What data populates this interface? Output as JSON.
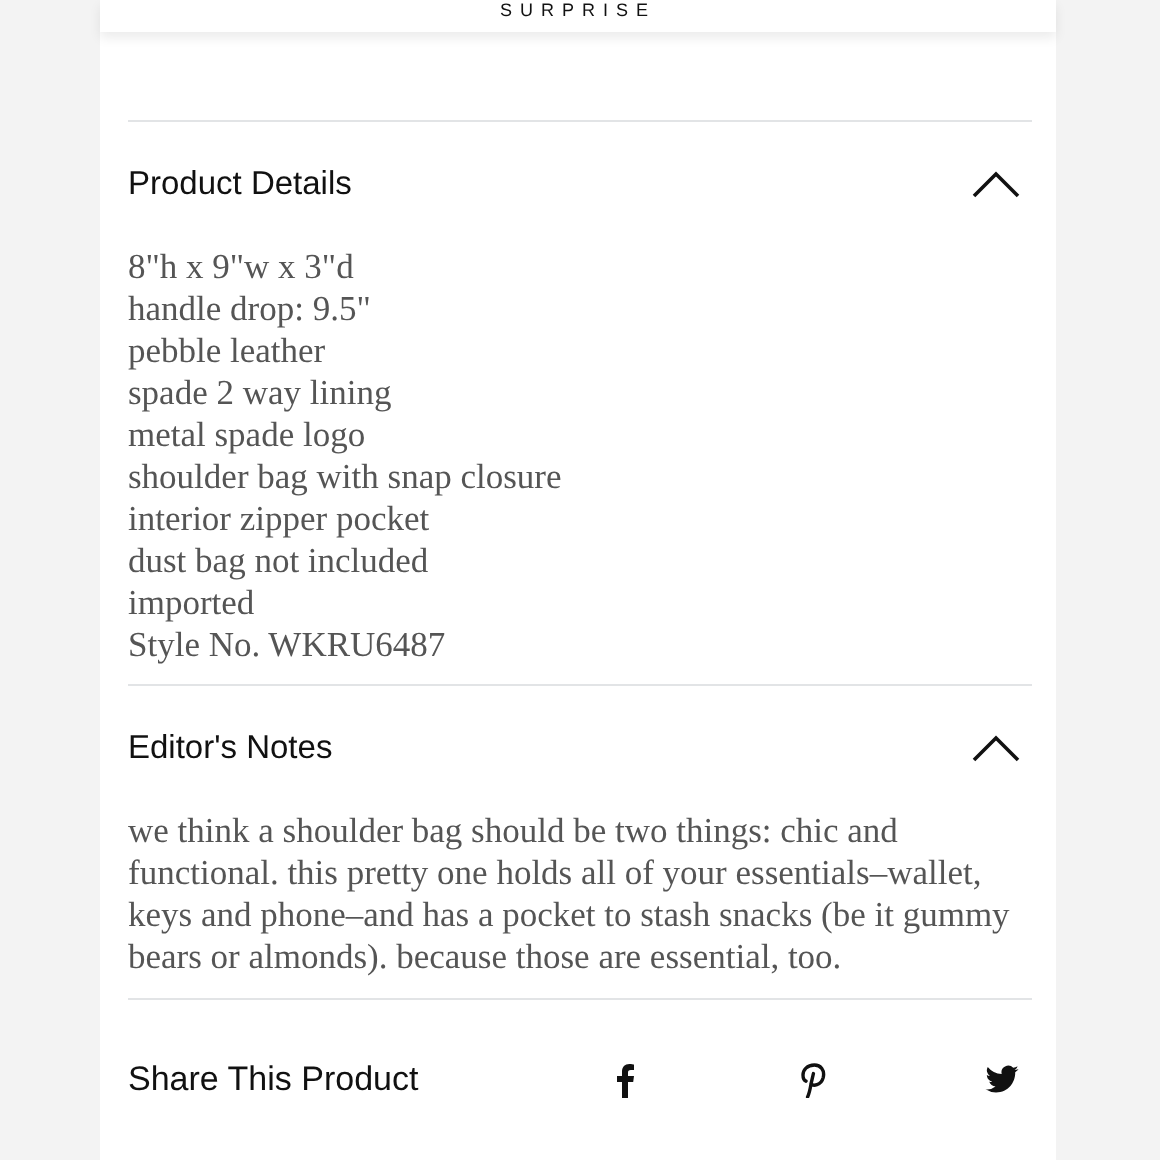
{
  "header": {
    "brand_tagline": "SURPRISE"
  },
  "sections": [
    {
      "title": "Product Details",
      "expanded": true,
      "kind": "list",
      "lines": [
        "8\"h x 9\"w x 3\"d",
        "handle drop: 9.5\"",
        "pebble leather",
        "spade 2 way lining",
        "metal spade logo",
        "shoulder bag with snap closure",
        "interior zipper pocket",
        "dust bag not included",
        "imported",
        "Style No. WKRU6487"
      ]
    },
    {
      "title": "Editor's Notes",
      "expanded": true,
      "kind": "paragraph",
      "text": "we think a shoulder bag should be two things: chic and functional. this pretty one holds all of your essentials–wallet, keys and phone–and has a pocket to stash snacks (be it gummy bears or almonds). because those are essential, too."
    }
  ],
  "share": {
    "label": "Share This Product",
    "networks": [
      {
        "kind": "facebook"
      },
      {
        "kind": "pinterest"
      },
      {
        "kind": "twitter"
      }
    ]
  }
}
